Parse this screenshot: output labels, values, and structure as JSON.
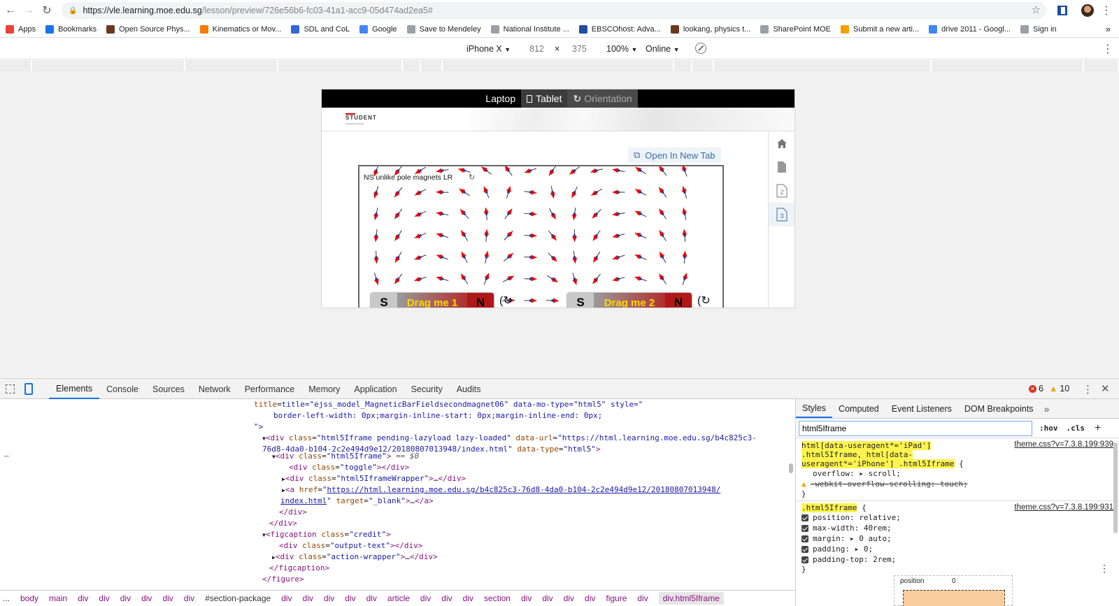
{
  "browser": {
    "url_host": "https://vle.learning.moe.edu.sg",
    "url_path": "/lesson/preview/726e56b6-fc03-41a1-acc9-05d474ad2ea5#",
    "bookmarks": [
      {
        "label": "Apps",
        "color": "#ea4335"
      },
      {
        "label": "Bookmarks",
        "color": "#1a73e8"
      },
      {
        "label": "Open Source Phys...",
        "color": "#6b3a1e"
      },
      {
        "label": "Kinematics or Mov...",
        "color": "#f57c00"
      },
      {
        "label": "SDL and CoL",
        "color": "#3367d6"
      },
      {
        "label": "Google",
        "color": "#4285f4"
      },
      {
        "label": "Save to Mendeley",
        "color": "#9aa0a6"
      },
      {
        "label": "National Institute ...",
        "color": "#9aa0a6"
      },
      {
        "label": "EBSCOhost: Adva...",
        "color": "#1e4e9c"
      },
      {
        "label": "lookang, physics t...",
        "color": "#6b3a1e"
      },
      {
        "label": "SharePoint MOE",
        "color": "#9aa0a6"
      },
      {
        "label": "Submit a new arti...",
        "color": "#f4a100"
      },
      {
        "label": "drive 2011 - Googl...",
        "color": "#4285f4"
      },
      {
        "label": "Sign in",
        "color": "#9aa0a6"
      }
    ],
    "more_bookmarks": "»"
  },
  "device_toolbar": {
    "device": "iPhone X",
    "width": "812",
    "times": "×",
    "height": "375",
    "zoom": "100%",
    "network": "Online"
  },
  "emulated_page": {
    "view_modes": [
      "Laptop",
      "Tablet",
      "Orientation"
    ],
    "logo_text": "STUDENT",
    "logo_sub": "LEARNING SPACE",
    "open_new_tab": "Open In New Tab",
    "sim_title": "NS unlike pole magnets LR",
    "magnet1": {
      "s": "S",
      "n": "N",
      "label": "Drag me 1"
    },
    "magnet2": {
      "s": "S",
      "n": "N",
      "label": "Drag me 2"
    },
    "nav_pages": [
      "1",
      "2",
      "3"
    ]
  },
  "devtools": {
    "tabs": [
      "Elements",
      "Console",
      "Sources",
      "Network",
      "Performance",
      "Memory",
      "Application",
      "Security",
      "Audits"
    ],
    "errors": "6",
    "warnings": "10",
    "breadcrumbs": [
      "...",
      "body",
      "main",
      "div",
      "div",
      "div",
      "div",
      "div",
      "div",
      "#section-package",
      "div",
      "div",
      "div",
      "div",
      "div",
      "article",
      "div",
      "div",
      "div",
      "section",
      "div",
      "div",
      "div",
      "div",
      "figure",
      "div",
      "div.html5Iframe"
    ],
    "elements_lines": {
      "l1a": "title=\"ejss_model_MagneticBarFieldsecondmagnet06\" data-mo-type=\"html5\" style=\"",
      "l1b": "border-left-width: 0px;margin-inline-start: 0px;margin-inline-end: 0px;",
      "l1c": "\">",
      "l2_class": "html5Iframe pending-lazyload lazy-loaded",
      "l2_url_attr": "data-url",
      "l2_url": "https://html.learning.moe.edu.sg/b4c825c3-",
      "l2_url2": "76d8-4da0-b104-2c2e494d9e12/20180807013948/index.html",
      "l2_type": "html5",
      "sel_class": "html5Iframe",
      "sel_suffix": "== $0",
      "toggle_class": "toggle",
      "wrapper_class": "html5IframeWrapper",
      "a_href": "https://html.learning.moe.edu.sg/b4c825c3-76d8-4da0-b104-2c2e494d9e12/20180807013948/",
      "a_href2": "index.html",
      "a_target": "_blank",
      "figcaption_class": "credit",
      "output_class": "output-text",
      "action_class": "action-wrapper"
    },
    "styles": {
      "tabs": [
        "Styles",
        "Computed",
        "Event Listeners",
        "DOM Breakpoints"
      ],
      "filter_value": "html5Iframe",
      "hov": ":hov",
      "cls": ".cls",
      "rule1_selector_a": "html[data-useragent*='iPad']",
      "rule1_selector_b": ".html5Iframe, html[data-",
      "rule1_selector_c": "useragent*='iPhone'] .html5Iframe",
      "rule1_source": "theme.css?v=7.3.8.199:939",
      "rule1_props": [
        "overflow: ▸ scroll;",
        "-webkit-overflow-scrolling: touch;"
      ],
      "rule2_selector": ".html5Iframe",
      "rule2_source": "theme.css?v=7.3.8.199:931",
      "rule2_props": [
        "position: relative;",
        "max-width: 40rem;",
        "margin: ▸ 0 auto;",
        "padding: ▸ 0;",
        "padding-top: 2rem;"
      ],
      "boxmodel_label": "position",
      "boxmodel_value": "0"
    }
  }
}
